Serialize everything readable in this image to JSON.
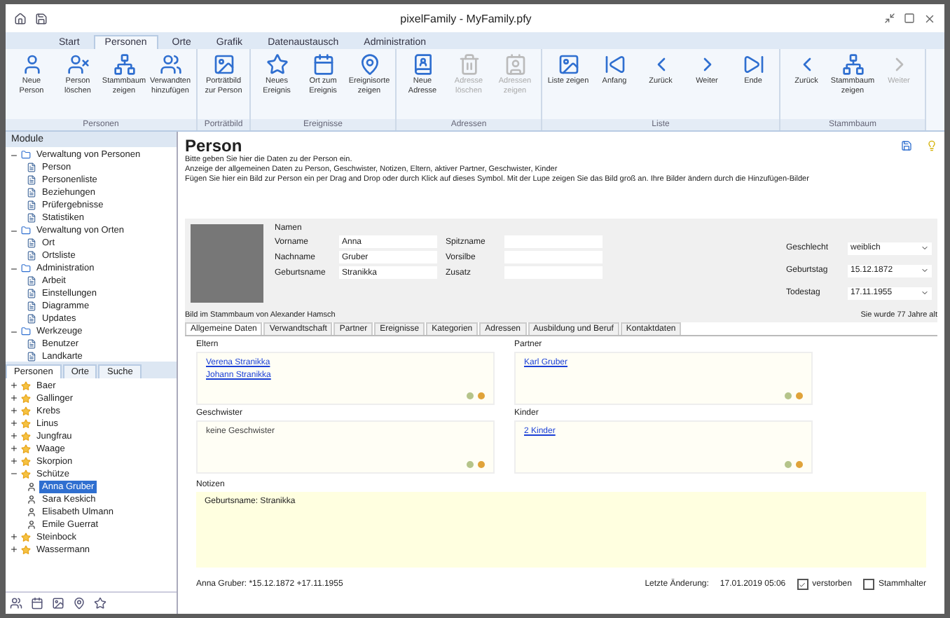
{
  "window": {
    "title": "pixelFamily - MyFamily.pfy"
  },
  "ribbon": {
    "tabs": [
      {
        "label": "Start",
        "selected": false
      },
      {
        "label": "Personen",
        "selected": true
      },
      {
        "label": "Orte",
        "selected": false
      },
      {
        "label": "Grafik",
        "selected": false
      },
      {
        "label": "Datenaustausch",
        "selected": false
      },
      {
        "label": "Administration",
        "selected": false
      }
    ],
    "groups": [
      {
        "label": "Personen",
        "buttons": [
          {
            "label": "Neue Person",
            "disabled": false
          },
          {
            "label": "Person löschen",
            "disabled": false
          },
          {
            "label": "Stammbaum zeigen",
            "disabled": false
          },
          {
            "label": "Verwandten hinzufügen",
            "disabled": false
          }
        ]
      },
      {
        "label": "Porträtbild",
        "buttons": [
          {
            "label": "Porträtbild zur Person",
            "disabled": false
          }
        ]
      },
      {
        "label": "Ereignisse",
        "buttons": [
          {
            "label": "Neues Ereignis",
            "disabled": false
          },
          {
            "label": "Ort zum Ereignis",
            "disabled": false
          },
          {
            "label": "Ereignisorte zeigen",
            "disabled": false
          }
        ]
      },
      {
        "label": "Adressen",
        "buttons": [
          {
            "label": "Neue Adresse",
            "disabled": false
          },
          {
            "label": "Adresse löschen",
            "disabled": true
          },
          {
            "label": "Adressen zeigen",
            "disabled": true
          }
        ]
      },
      {
        "label": "Liste",
        "buttons": [
          {
            "label": "Liste zeigen",
            "disabled": false
          },
          {
            "label": "Anfang",
            "disabled": false
          },
          {
            "label": "Zurück",
            "disabled": false
          },
          {
            "label": "Weiter",
            "disabled": false
          },
          {
            "label": "Ende",
            "disabled": false
          }
        ]
      },
      {
        "label": "Stammbaum",
        "buttons": [
          {
            "label": "Zurück",
            "disabled": false
          },
          {
            "label": "Stammbaum zeigen",
            "disabled": false
          },
          {
            "label": "Weiter",
            "disabled": true
          }
        ]
      }
    ]
  },
  "modules": {
    "title": "Module",
    "items": [
      {
        "label": "Verwaltung von Personen",
        "expanded": true,
        "children": [
          {
            "label": "Person"
          },
          {
            "label": "Personenliste"
          },
          {
            "label": "Beziehungen"
          },
          {
            "label": "Prüfergebnisse"
          },
          {
            "label": "Statistiken"
          }
        ]
      },
      {
        "label": "Verwaltung von Orten",
        "expanded": true,
        "children": [
          {
            "label": "Ort"
          },
          {
            "label": "Ortsliste"
          }
        ]
      },
      {
        "label": "Administration",
        "expanded": true,
        "children": [
          {
            "label": "Arbeit"
          },
          {
            "label": "Einstellungen"
          },
          {
            "label": "Diagramme"
          },
          {
            "label": "Updates"
          }
        ]
      },
      {
        "label": "Werkzeuge",
        "expanded": true,
        "children": [
          {
            "label": "Benutzer"
          },
          {
            "label": "Landkarte"
          }
        ]
      }
    ]
  },
  "navigator": {
    "tabs": [
      {
        "label": "Personen",
        "selected": true
      },
      {
        "label": "Orte",
        "selected": false
      },
      {
        "label": "Suche",
        "selected": false
      }
    ],
    "items": [
      {
        "label": "Baer",
        "expanded": false
      },
      {
        "label": "Gallinger",
        "expanded": false
      },
      {
        "label": "Krebs",
        "expanded": false
      },
      {
        "label": "Linus",
        "expanded": false
      },
      {
        "label": "Jungfrau",
        "expanded": false
      },
      {
        "label": "Waage",
        "expanded": false
      },
      {
        "label": "Skorpion",
        "expanded": false
      },
      {
        "label": "Schütze",
        "expanded": true,
        "children": [
          {
            "label": "Anna Gruber",
            "selected": true
          },
          {
            "label": "Sara Keskich",
            "selected": false
          },
          {
            "label": "Elisabeth Ulmann",
            "selected": false
          },
          {
            "label": "Emile Guerrat",
            "selected": false
          }
        ]
      },
      {
        "label": "Steinbock",
        "expanded": false
      },
      {
        "label": "Wassermann",
        "expanded": false
      }
    ]
  },
  "person": {
    "title": "Person",
    "intro": [
      "Bitte geben Sie hier die Daten zu der Person ein.",
      "Anzeige der allgemeinen Daten zu Person, Geschwister, Notizen, Eltern, aktiver Partner, Geschwister, Kinder",
      "Fügen Sie hier ein Bild zur Person ein per Drag and Drop oder durch Klick auf dieses Symbol. Mit der Lupe zeigen Sie das Bild groß an. Ihre Bilder ändern durch die Hinzufügen-Bilder"
    ],
    "names_title": "Namen",
    "fields": [
      {
        "label": "Vorname",
        "value": "Anna"
      },
      {
        "label": "Spitzname"
      },
      {
        "label": "Nachname",
        "value": "Gruber"
      },
      {
        "label": "Vorsilbe"
      },
      {
        "label": "Geburtsname",
        "value": "Stranikka"
      },
      {
        "label": "Zusatz"
      }
    ],
    "dates": [
      {
        "label": "Geschlecht",
        "value": "weiblich"
      },
      {
        "label": "Geburtstag",
        "value": "15.12.1872"
      },
      {
        "label": "Todestag",
        "value": "17.11.1955"
      }
    ],
    "photo_caption": "Bild im Stammbaum von Alexander Hamsch",
    "age": "Sie wurde 77 Jahre alt",
    "tabs": [
      {
        "label": "Allgemeine Daten",
        "selected": true
      },
      {
        "label": "Verwandtschaft",
        "selected": false
      },
      {
        "label": "Partner",
        "selected": false
      },
      {
        "label": "Ereignisse",
        "selected": false
      },
      {
        "label": "Kategorien",
        "selected": false
      },
      {
        "label": "Adressen",
        "selected": false
      },
      {
        "label": "Ausbildung und Beruf",
        "selected": false
      },
      {
        "label": "Kontaktdaten",
        "selected": false
      }
    ],
    "boxes": [
      {
        "title": "Eltern",
        "entries": [
          {
            "text": "Verena Stranikka",
            "kind": "link"
          },
          {
            "text": "Johann Stranikka",
            "kind": "link"
          }
        ]
      },
      {
        "title": "Partner",
        "entries": [
          {
            "text": "Karl Gruber",
            "kind": "link"
          }
        ]
      },
      {
        "title": "Geschwister",
        "entries": [
          {
            "text": "keine Geschwister",
            "kind": "plain"
          }
        ]
      },
      {
        "title": "Kinder",
        "entries": [
          {
            "text": "2 Kinder",
            "kind": "link"
          }
        ]
      }
    ],
    "notes": {
      "title": "Notizen",
      "value": "Geburtsname: Stranikka"
    },
    "footer": {
      "summary": "Anna Gruber: *15.12.1872 +17.11.1955",
      "changed_label": "Letzte Änderung:",
      "changed": "17.01.2019 05:06",
      "checks": [
        {
          "label": "verstorben",
          "checked": true
        },
        {
          "label": "Stammhalter",
          "checked": false
        }
      ]
    }
  }
}
